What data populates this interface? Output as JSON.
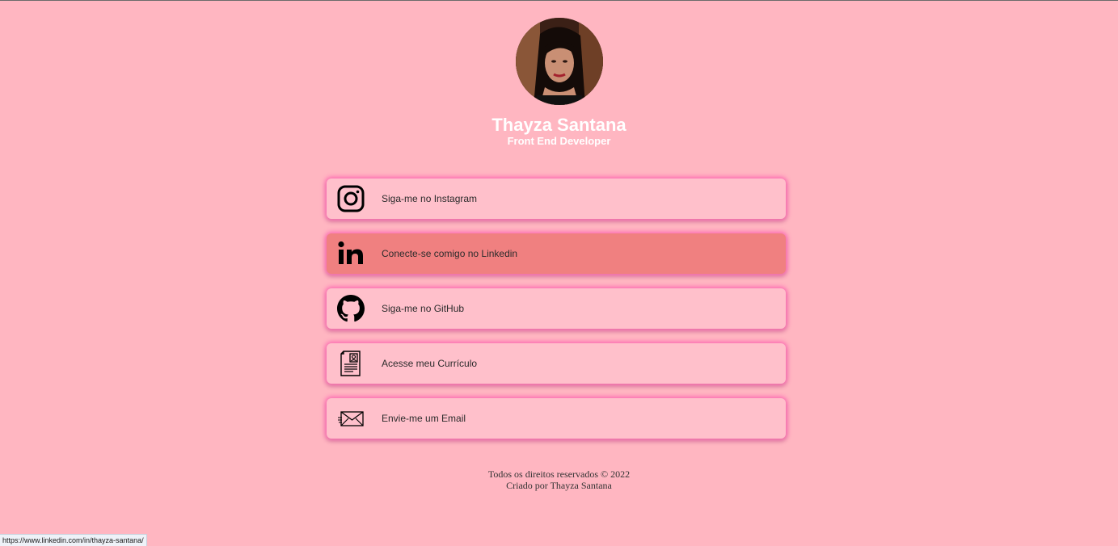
{
  "profile": {
    "avatar_icon": "profile-photo",
    "name": "Thayza Santana",
    "role": "Front End Developer"
  },
  "links": [
    {
      "label": "Siga-me no Instagram",
      "icon": "instagram-icon"
    },
    {
      "label": "Conecte-se comigo no Linkedin",
      "icon": "linkedin-icon",
      "state": "hover"
    },
    {
      "label": "Siga-me no GitHub",
      "icon": "github-icon"
    },
    {
      "label": "Acesse meu Currículo",
      "icon": "resume-icon"
    },
    {
      "label": "Envie-me um Email",
      "icon": "email-icon"
    }
  ],
  "footer": {
    "copyright": "Todos os direitos reservados © 2022",
    "credit": "Criado por Thayza Santana"
  },
  "status_bar": {
    "url": "https://www.linkedin.com/in/thayza-santana/"
  },
  "colors": {
    "background": "#ffb6c1",
    "card": "#ffc0cb",
    "card_hover": "#f08080",
    "card_glow": "#ff69b4"
  }
}
